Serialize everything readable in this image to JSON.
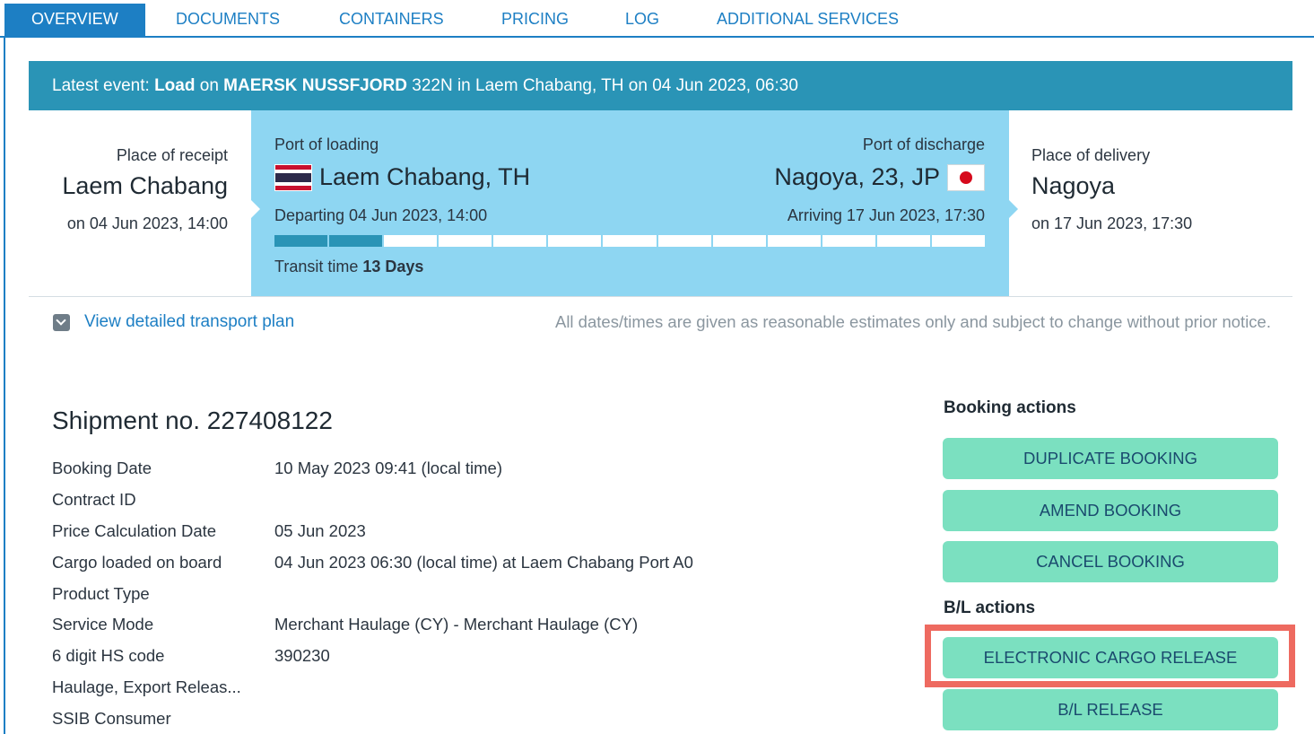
{
  "tabs": [
    {
      "label": "OVERVIEW",
      "active": true
    },
    {
      "label": "DOCUMENTS",
      "active": false
    },
    {
      "label": "CONTAINERS",
      "active": false
    },
    {
      "label": "PRICING",
      "active": false
    },
    {
      "label": "LOG",
      "active": false
    },
    {
      "label": "ADDITIONAL SERVICES",
      "active": false
    }
  ],
  "latest_event": {
    "prefix": "Latest event: ",
    "event": "Load",
    "on": " on ",
    "vessel": "MAERSK NUSSFJORD",
    "rest": " 322N in Laem Chabang, TH on 04 Jun 2023, 06:30"
  },
  "route": {
    "receipt": {
      "label": "Place of receipt",
      "name": "Laem Chabang",
      "date": "on 04 Jun 2023, 14:00"
    },
    "loading": {
      "label": "Port of loading",
      "name": "Laem Chabang, TH",
      "flag_icon": "thailand-flag-icon",
      "departing": "Departing 04 Jun 2023, 14:00"
    },
    "discharge": {
      "label": "Port of discharge",
      "name": "Nagoya, 23, JP",
      "flag_icon": "japan-flag-icon",
      "arriving": "Arriving 17 Jun 2023, 17:30"
    },
    "delivery": {
      "label": "Place of delivery",
      "name": "Nagoya",
      "date": "on 17 Jun 2023, 17:30"
    },
    "progress": {
      "segments_total": 13,
      "segments_done": 2
    },
    "transit_label": "Transit time ",
    "transit_value": "13 Days"
  },
  "plan": {
    "link_label": "View detailed transport plan",
    "icon": "chevron-down-icon",
    "disclaimer": "All dates/times are given as reasonable estimates only and subject to change without prior notice."
  },
  "shipment": {
    "title": "Shipment no. 227408122",
    "details": [
      {
        "key": "Booking Date",
        "value": "10 May 2023 09:41 (local time)"
      },
      {
        "key": "Contract ID",
        "value": ""
      },
      {
        "key": "Price Calculation Date",
        "value": "05 Jun 2023"
      },
      {
        "key": "Cargo loaded on board",
        "value": "04 Jun 2023 06:30 (local time) at Laem Chabang Port A0"
      },
      {
        "key": "Product Type",
        "value": ""
      },
      {
        "key": "Service Mode",
        "value": "Merchant Haulage (CY) - Merchant Haulage (CY)"
      },
      {
        "key": "6 digit HS code",
        "value": "390230"
      },
      {
        "key": "Haulage, Export Releas...",
        "value": ""
      },
      {
        "key": "SSIB Consumer",
        "value": ""
      }
    ]
  },
  "actions": {
    "booking_heading": "Booking actions",
    "booking_buttons": [
      "DUPLICATE BOOKING",
      "AMEND BOOKING",
      "CANCEL BOOKING"
    ],
    "bl_heading": "B/L actions",
    "bl_buttons": [
      "ELECTRONIC CARGO RELEASE",
      "B/L RELEASE"
    ]
  },
  "colors": {
    "accent": "#1d7fc4",
    "banner": "#2a94b6",
    "route_panel": "#8ed6f2",
    "action_button": "#7be0c0",
    "highlight": "#ee6a60"
  }
}
